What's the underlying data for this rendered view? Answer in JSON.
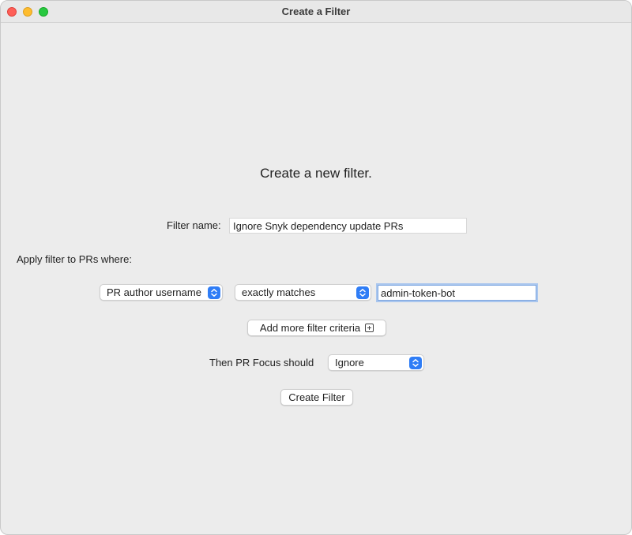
{
  "window": {
    "title": "Create a Filter"
  },
  "form": {
    "heading": "Create a new filter.",
    "filter_name_label": "Filter name:",
    "filter_name_value": "Ignore Snyk dependency update PRs",
    "apply_label": "Apply filter to PRs where:",
    "criteria": {
      "field_selected": "PR author username",
      "operator_selected": "exactly matches",
      "value": "admin-token-bot"
    },
    "add_criteria_label": "Add more filter criteria",
    "action_label": "Then PR Focus should",
    "action_selected": "Ignore",
    "submit_label": "Create Filter"
  },
  "colors": {
    "accent": "#2f7df6",
    "focus_ring": "#a9c6ee",
    "window_bg": "#ececec"
  },
  "icons": {
    "popup_stepper": "up-down-chevron-icon",
    "add_criteria": "plus-square-icon"
  }
}
